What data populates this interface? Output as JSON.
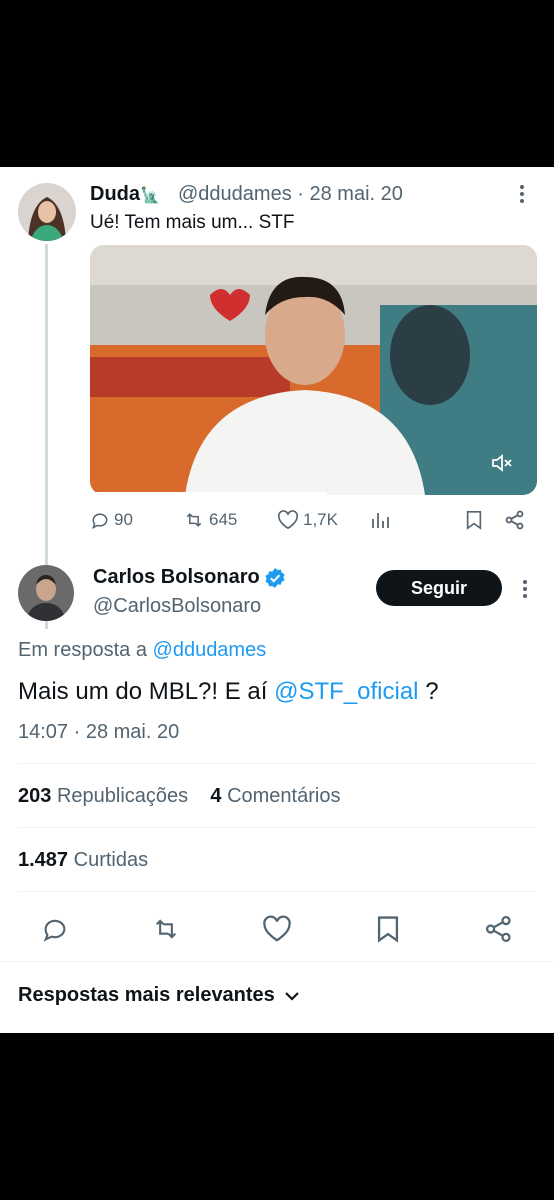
{
  "thread": {
    "parent": {
      "name": "Duda",
      "name_emoji": "🗽",
      "handle": "@ddudames",
      "separator": "·",
      "date": "28 mai. 20",
      "text": "Ué! Tem mais um... STF",
      "video_progress": 0.53,
      "actions": {
        "replies": "90",
        "reposts": "645",
        "likes": "1,7K"
      }
    },
    "reply": {
      "name": "Carlos Bolsonaro",
      "handle": "@CarlosBolsonaro",
      "verified": true,
      "follow_label": "Seguir",
      "in_reply_prefix": "Em resposta a",
      "in_reply_handle": "@ddudames",
      "text_before": "Mais um do MBL?! E aí",
      "mention": "@STF_oficial",
      "text_after": "?",
      "timestamp": "14:07 · 28 mai. 20",
      "reposts_count": "203",
      "reposts_label": "Republicações",
      "comments_count": "4",
      "comments_label": "Comentários",
      "likes_count": "1.487",
      "likes_label": "Curtidas"
    }
  },
  "replies_sort": {
    "label": "Respostas mais relevantes"
  },
  "colors": {
    "accent": "#1d9bf0",
    "text": "#0f1419",
    "secondary": "#536471"
  }
}
